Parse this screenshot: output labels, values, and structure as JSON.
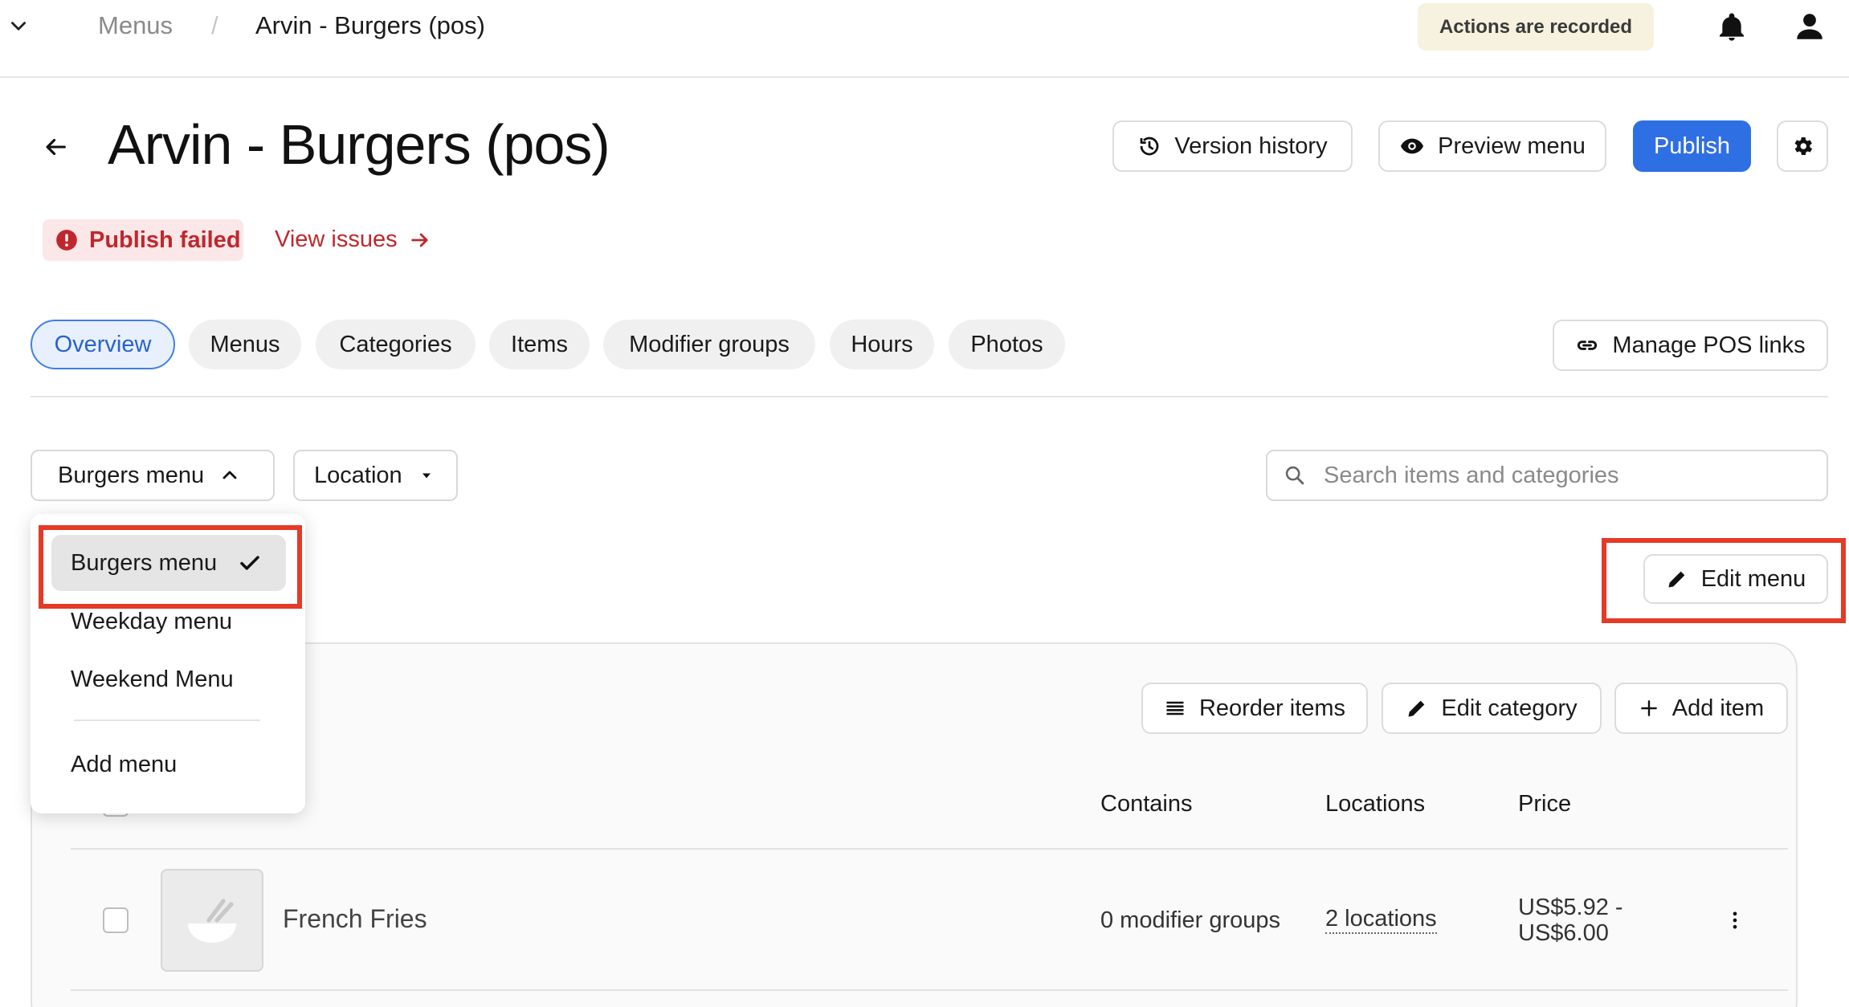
{
  "topbar": {
    "breadcrumb_parent": "Menus",
    "breadcrumb_separator": "/",
    "breadcrumb_current": "Arvin - Burgers (pos)",
    "recorded_badge": "Actions are recorded"
  },
  "header": {
    "title": "Arvin - Burgers (pos)",
    "version_history": "Version history",
    "preview_menu": "Preview menu",
    "publish": "Publish"
  },
  "status": {
    "badge": "Publish failed",
    "view_issues": "View issues"
  },
  "tabs": [
    {
      "label": "Overview",
      "active": true
    },
    {
      "label": "Menus"
    },
    {
      "label": "Categories"
    },
    {
      "label": "Items"
    },
    {
      "label": "Modifier groups"
    },
    {
      "label": "Hours"
    },
    {
      "label": "Photos"
    }
  ],
  "manage_pos_links": "Manage POS links",
  "filters": {
    "menu_select": "Burgers menu",
    "location_select": "Location",
    "search_placeholder": "Search items and categories"
  },
  "menu_dropdown": {
    "options": [
      "Burgers menu",
      "Weekday menu",
      "Weekend Menu"
    ],
    "selected": "Burgers menu",
    "add": "Add menu"
  },
  "edit_menu": "Edit menu",
  "category_actions": {
    "reorder": "Reorder items",
    "edit_category": "Edit category",
    "add_item": "Add item"
  },
  "table": {
    "columns": [
      "Contains",
      "Locations",
      "Price"
    ],
    "rows": [
      {
        "name": "French Fries",
        "contains": "0 modifier groups",
        "locations": "2 locations",
        "price_low": "US$5.92 -",
        "price_high": "US$6.00"
      }
    ]
  },
  "colors": {
    "primary": "#2f6fe4",
    "error": "#c0272d",
    "highlight": "#e53a26",
    "recorded_bg": "#f7f1df"
  }
}
